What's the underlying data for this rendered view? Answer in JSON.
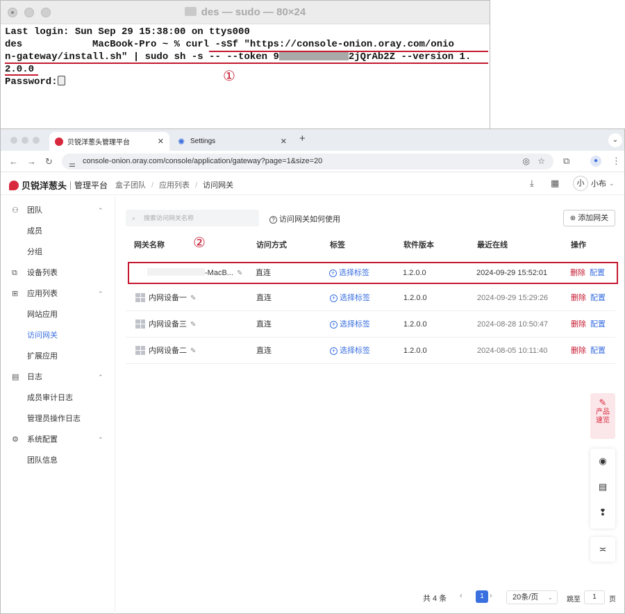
{
  "terminal": {
    "title": "des — sudo — 80×24",
    "line1": "Last login: Sun Sep 29 15:38:00 on ttys000",
    "line2_prefix": "des            MacBook-Pro ~ % ",
    "line2_cmd": "curl -sSf \"https://console-onion.oray.com/onio",
    "line3_a": "n-gateway/install.sh\" | sudo sh -s -- --token 9",
    "line3_b": "2jQrAb2Z --version 1.",
    "line4": "2.0.0",
    "line5": "Password:",
    "annotation": "①"
  },
  "browser": {
    "tabs": [
      {
        "label": "贝锐洋葱头管理平台"
      },
      {
        "label": "Settings"
      }
    ],
    "url": "console-onion.oray.com/console/application/gateway?page=1&size=20"
  },
  "app": {
    "brand": "贝锐洋葱头",
    "platform": "管理平台",
    "breadcrumb": [
      "盒子团队",
      "应用列表",
      "访问网关"
    ],
    "user_initial": "小",
    "user_name": "小布"
  },
  "sidebar": {
    "items": [
      {
        "label": "团队",
        "icon": "team-icon"
      },
      {
        "label": "成员"
      },
      {
        "label": "分组"
      },
      {
        "label": "设备列表",
        "icon": "device-icon"
      },
      {
        "label": "应用列表",
        "icon": "app-icon"
      },
      {
        "label": "网站应用"
      },
      {
        "label": "访问网关"
      },
      {
        "label": "扩展应用"
      },
      {
        "label": "日志",
        "icon": "log-icon"
      },
      {
        "label": "成员审计日志"
      },
      {
        "label": "管理员操作日志"
      },
      {
        "label": "系统配置",
        "icon": "settings-icon"
      },
      {
        "label": "团队信息"
      }
    ]
  },
  "main": {
    "search_placeholder": "搜索访问网关名称",
    "help_link": "访问网关如何使用",
    "add_button": "添加网关",
    "annotation": "②",
    "columns": [
      "网关名称",
      "访问方式",
      "标签",
      "软件版本",
      "最近在线",
      "操作"
    ],
    "rows": [
      {
        "name": "-MacB...",
        "access": "直连",
        "tag": "选择标签",
        "version": "1.2.0.0",
        "last_online": "2024-09-29 15:52:01",
        "delete": "删除",
        "config": "配置"
      },
      {
        "name": "内网设备一",
        "access": "直连",
        "tag": "选择标签",
        "version": "1.2.0.0",
        "last_online": "2024-09-29 15:29:26",
        "delete": "删除",
        "config": "配置"
      },
      {
        "name": "内网设备三",
        "access": "直连",
        "tag": "选择标签",
        "version": "1.2.0.0",
        "last_online": "2024-08-28 10:50:47",
        "delete": "删除",
        "config": "配置"
      },
      {
        "name": "内网设备二",
        "access": "直连",
        "tag": "选择标签",
        "version": "1.2.0.0",
        "last_online": "2024-08-05 10:11:40",
        "delete": "删除",
        "config": "配置"
      }
    ],
    "pagination": {
      "total": "共 4 条",
      "page": "1",
      "size": "20条/页",
      "jump_label": "跳至",
      "jump_value": "1",
      "jump_suffix": "页"
    },
    "float_product": "产品速览"
  },
  "colors": {
    "accent": "#3a6fe0",
    "brand": "#d8283c",
    "highlight": "#c4182f"
  }
}
